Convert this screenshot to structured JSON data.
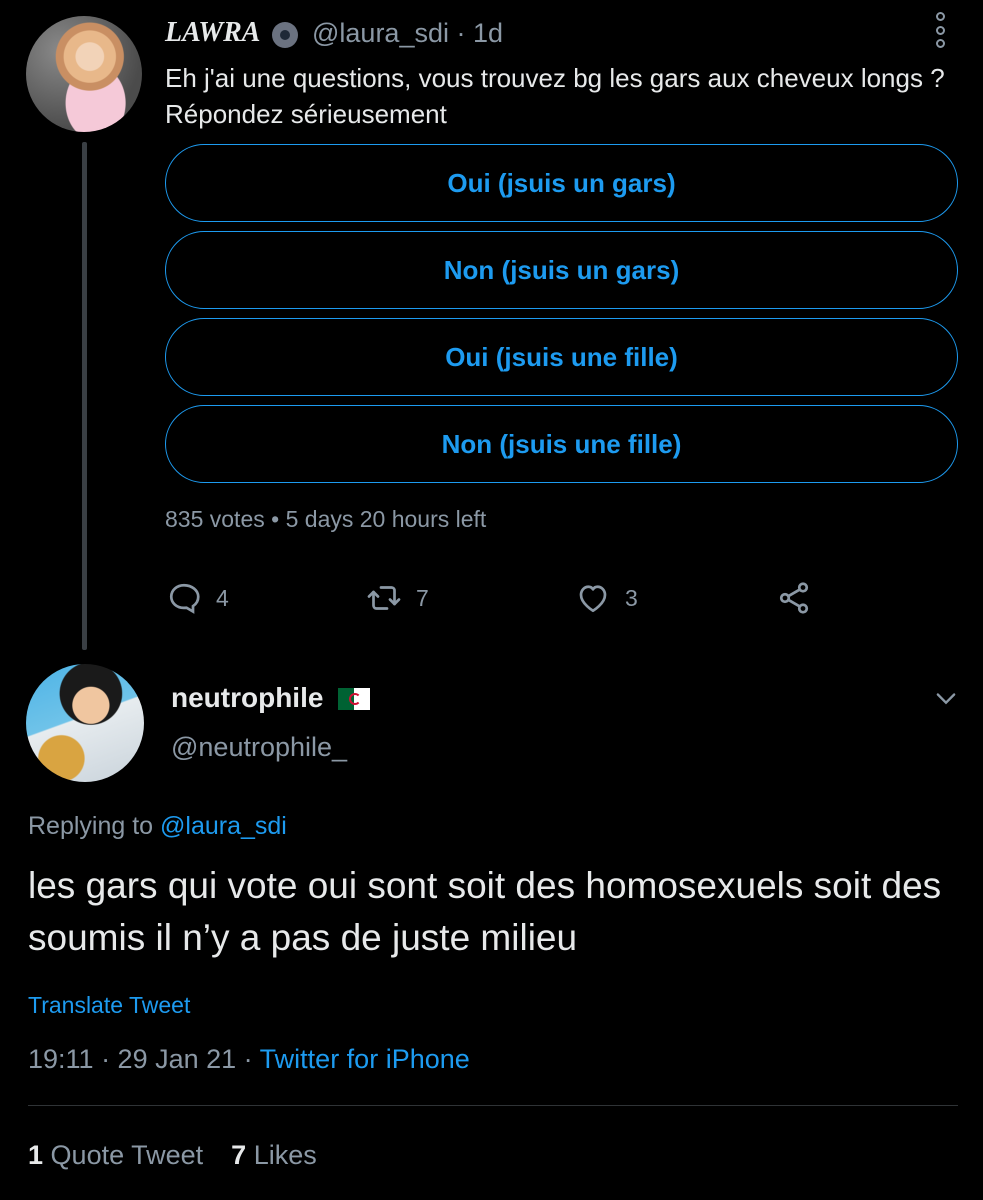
{
  "parent_tweet": {
    "display_name": "LAWRA",
    "handle": "@laura_sdi",
    "time": "· 1d",
    "text": "Eh j'ai une questions, vous trouvez bg les gars aux cheveux longs ? Répondez sérieusement",
    "poll": {
      "options": [
        "Oui (jsuis un gars)",
        "Non (jsuis un gars)",
        "Oui (jsuis une fille)",
        "Non (jsuis une fille)"
      ],
      "votes": "835 votes",
      "separator": "•",
      "time_left": "5 days 20 hours left"
    },
    "actions": {
      "replies": "4",
      "retweets": "7",
      "likes": "3"
    },
    "icons": [
      "more-icon",
      "reply-icon",
      "retweet-icon",
      "like-icon",
      "share-icon",
      "badge-icon"
    ]
  },
  "reply_tweet": {
    "display_name": "neutrophile",
    "handle": "@neutrophile_",
    "replying_prefix": "Replying to",
    "replying_to": "@laura_sdi",
    "text": "les gars qui vote oui sont soit des homosexuels soit des soumis il n’y a pas de juste milieu",
    "translate_label": "Translate Tweet",
    "time": "19:11 · 29 Jan 21 ·",
    "source": "Twitter for iPhone",
    "stats": {
      "quote_count": "1",
      "quote_label": "Quote Tweet",
      "like_count": "7",
      "like_label": "Likes"
    },
    "icons": [
      "chevron-down-icon",
      "algeria-flag-icon"
    ]
  },
  "colors": {
    "background": "#000000",
    "accent": "#1d9bf0",
    "secondary_text": "#8b98a5",
    "primary_text": "#e7e9ea"
  }
}
